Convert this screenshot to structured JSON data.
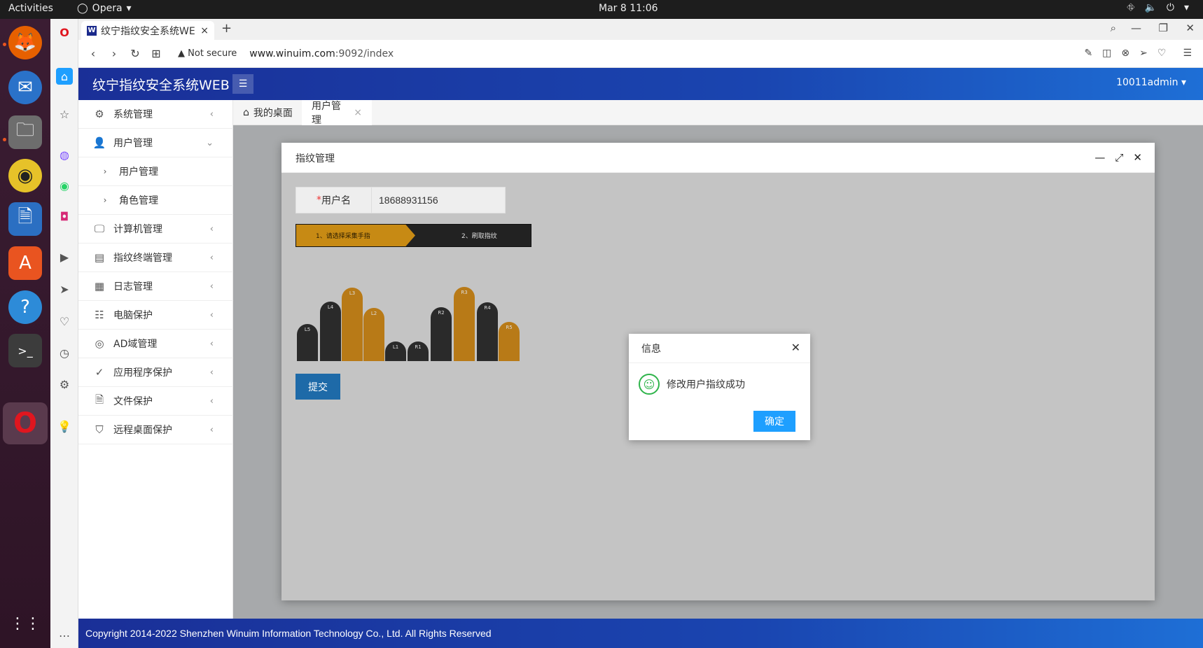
{
  "os": {
    "activities": "Activities",
    "app_menu": "Opera",
    "clock": "Mar 8  11:06",
    "tray": [
      "⛗",
      "🔈",
      "⏻",
      "▾"
    ]
  },
  "browser": {
    "tab_title": "纹宁指纹安全系统WEB",
    "tab_logo": "W",
    "new_tab": "+",
    "not_secure": "Not secure",
    "url_host": "www.winuim.com",
    "url_path": ":9092/index"
  },
  "app": {
    "brand": "纹宁指纹安全系统WEB",
    "user": "10011admin",
    "menu": [
      {
        "label": "系统管理",
        "icon": "⚙",
        "arrow": "‹"
      },
      {
        "label": "用户管理",
        "icon": "👤",
        "arrow": "⌄"
      },
      {
        "label": "用户管理",
        "icon": "›",
        "sub": true
      },
      {
        "label": "角色管理",
        "icon": "›",
        "sub": true
      },
      {
        "label": "计算机管理",
        "icon": "🖵",
        "arrow": "‹"
      },
      {
        "label": "指纹终端管理",
        "icon": "▤",
        "arrow": "‹"
      },
      {
        "label": "日志管理",
        "icon": "▦",
        "arrow": "‹"
      },
      {
        "label": "电脑保护",
        "icon": "☷",
        "arrow": "‹"
      },
      {
        "label": "AD域管理",
        "icon": "◎",
        "arrow": "‹"
      },
      {
        "label": "应用程序保护",
        "icon": "✓",
        "arrow": "‹"
      },
      {
        "label": "文件保护",
        "icon": "🗎",
        "arrow": "‹"
      },
      {
        "label": "远程桌面保护",
        "icon": "⛉",
        "arrow": "‹"
      }
    ],
    "tabs": {
      "home": "我的桌面",
      "users": "用户管理",
      "close": "×"
    },
    "footer": "Copyright 2014-2022 Shenzhen Winuim Information Technology Co., Ltd. All Rights Reserved"
  },
  "modal": {
    "title": "指纹管理",
    "username_label": "用户名",
    "username_value": "18688931156",
    "step1": "1、请选择采集手指",
    "step2": "2、刷取指纹",
    "fingers": [
      {
        "label": "L5",
        "state": "enrolled"
      },
      {
        "label": "L4",
        "state": "enrolled"
      },
      {
        "label": "L3",
        "state": "selected"
      },
      {
        "label": "L2",
        "state": "selected"
      },
      {
        "label": "L1",
        "state": "enrolled"
      },
      {
        "label": "R1",
        "state": "enrolled"
      },
      {
        "label": "R2",
        "state": "enrolled"
      },
      {
        "label": "R3",
        "state": "selected"
      },
      {
        "label": "R4",
        "state": "enrolled"
      },
      {
        "label": "R5",
        "state": "selected"
      }
    ],
    "submit": "提交"
  },
  "info": {
    "title": "信息",
    "message": "修改用户指纹成功",
    "ok": "确定"
  },
  "colors": {
    "header": "#1a2f97",
    "accent": "#1e9fff",
    "finger_selected": "#b87a17",
    "finger_dark": "#2a2a2a"
  }
}
